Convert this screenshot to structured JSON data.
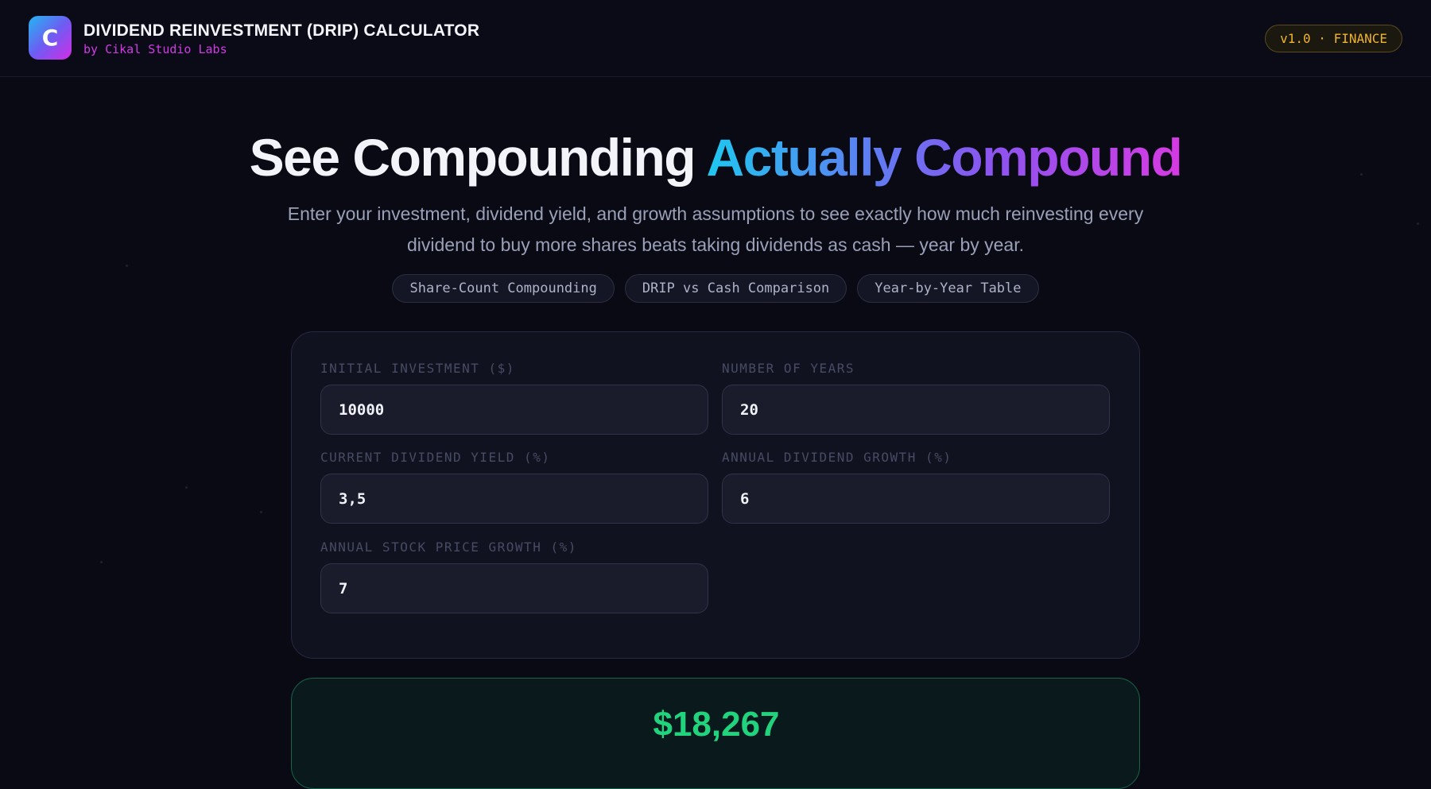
{
  "header": {
    "logo_letter": "C",
    "title": "DIVIDEND REINVESTMENT (DRIP) CALCULATOR",
    "subtitle": "by Cikal Studio Labs",
    "version_badge": "v1.0 · FINANCE"
  },
  "hero": {
    "title_plain": "See Compounding ",
    "title_accent": "Actually Compound",
    "description": "Enter your investment, dividend yield, and growth assumptions to see exactly how much reinvesting every dividend to buy more shares beats taking dividends as cash — year by year."
  },
  "chips": [
    "Share-Count Compounding",
    "DRIP vs Cash Comparison",
    "Year-by-Year Table"
  ],
  "form": {
    "initial_investment": {
      "label": "INITIAL INVESTMENT ($)",
      "value": "10000"
    },
    "number_of_years": {
      "label": "NUMBER OF YEARS",
      "value": "20"
    },
    "dividend_yield": {
      "label": "CURRENT DIVIDEND YIELD (%)",
      "value": "3,5"
    },
    "dividend_growth": {
      "label": "ANNUAL DIVIDEND GROWTH (%)",
      "value": "6"
    },
    "price_growth": {
      "label": "ANNUAL STOCK PRICE GROWTH (%)",
      "value": "7"
    }
  },
  "result": {
    "value": "$18,267"
  },
  "colors": {
    "background": "#090a14",
    "accent_magenta": "#d23ae6",
    "accent_cyan": "#1ec8f0",
    "badge_gold": "#f0b429",
    "result_green": "#22d37e"
  }
}
